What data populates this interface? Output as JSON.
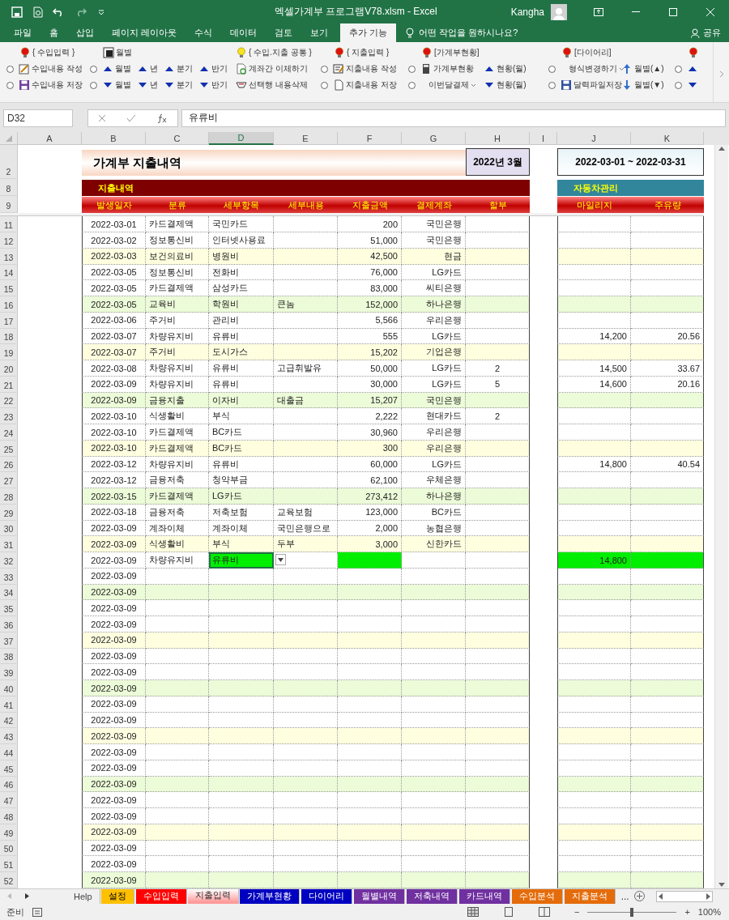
{
  "window": {
    "title": "엑셀가계부 프로그램V78.xlsm  -  Excel",
    "user": "Kangha"
  },
  "menu_tabs": [
    {
      "label": "파일",
      "selected": false
    },
    {
      "label": "홈",
      "selected": false
    },
    {
      "label": "삽입",
      "selected": false
    },
    {
      "label": "페이지 레이아웃",
      "selected": false
    },
    {
      "label": "수식",
      "selected": false
    },
    {
      "label": "데이터",
      "selected": false
    },
    {
      "label": "검토",
      "selected": false
    },
    {
      "label": "보기",
      "selected": false
    },
    {
      "label": "추가 기능",
      "selected": true
    }
  ],
  "tell_me": {
    "placeholder": "어떤 작업을 원하시나요?"
  },
  "share": "공유",
  "ribbon": {
    "columns": [
      {
        "cells": [
          [
            {
              "kind": "item",
              "label": "{ 수입입력 }"
            }
          ],
          [
            {
              "kind": "radio",
              "selected": false
            },
            {
              "kind": "item",
              "label": "수입내용 작성"
            }
          ],
          [
            {
              "kind": "radio",
              "selected": false
            },
            {
              "kind": "item",
              "label": "수입내용 저장"
            }
          ]
        ]
      },
      {
        "cells": [
          [
            {
              "kind": "item",
              "label": "월별"
            }
          ],
          [
            {
              "kind": "radio",
              "selected": false
            },
            {
              "kind": "item",
              "label": "월별"
            },
            {
              "kind": "item",
              "label": "년"
            },
            {
              "kind": "item",
              "label": "분기"
            },
            {
              "kind": "item",
              "label": "반기"
            }
          ],
          [
            {
              "kind": "radio",
              "selected": false
            },
            {
              "kind": "item",
              "label": "월별"
            },
            {
              "kind": "item",
              "label": "년"
            },
            {
              "kind": "item",
              "label": "분기"
            },
            {
              "kind": "item",
              "label": "반기"
            }
          ]
        ]
      },
      {
        "cells": [
          [
            {
              "kind": "item",
              "label": "{ 수입.지출 공통 }"
            }
          ],
          [
            {
              "kind": "item",
              "label": "계좌간 이체하기"
            }
          ],
          [
            {
              "kind": "item",
              "label": "선택행 내용삭제"
            }
          ]
        ]
      },
      {
        "cells": [
          [
            {
              "kind": "item",
              "label": "{ 지출입력 }"
            }
          ],
          [
            {
              "kind": "radio",
              "selected": false
            },
            {
              "kind": "item",
              "label": "지출내용 작성"
            }
          ],
          [
            {
              "kind": "radio",
              "selected": false
            },
            {
              "kind": "item",
              "label": "지출내용 저장"
            }
          ]
        ]
      },
      {
        "cells": [
          [
            {
              "kind": "item",
              "label": "[가계부현황]"
            }
          ],
          [
            {
              "kind": "radio",
              "selected": false
            },
            {
              "kind": "item",
              "label": "가계부현황"
            }
          ],
          [
            {
              "kind": "radio",
              "selected": false
            },
            {
              "kind": "menu",
              "label": "이번달결제"
            }
          ]
        ]
      },
      {
        "cells": [
          [],
          [
            {
              "kind": "item",
              "label": "현황(월)"
            }
          ],
          [
            {
              "kind": "item",
              "label": "현황(월)"
            }
          ]
        ]
      },
      {
        "cells": [
          [
            {
              "kind": "item",
              "label": "[다이어리]"
            }
          ],
          [
            {
              "kind": "radio",
              "selected": false
            },
            {
              "kind": "menu",
              "label": "형식변경하기"
            }
          ],
          [
            {
              "kind": "radio",
              "selected": false
            },
            {
              "kind": "item",
              "label": "달력파일저장"
            }
          ]
        ]
      },
      {
        "cells": [
          [],
          [
            {
              "kind": "item",
              "label": "월별(▲)"
            }
          ],
          [
            {
              "kind": "item",
              "label": "월별(▼)"
            }
          ]
        ]
      },
      {
        "cells": [
          [
            {
              "kind": "item"
            }
          ],
          [
            {
              "kind": "radio",
              "selected": false
            },
            {
              "kind": "item"
            }
          ],
          [
            {
              "kind": "radio",
              "selected": false
            },
            {
              "kind": "item"
            }
          ]
        ]
      }
    ]
  },
  "formula_bar": {
    "name_box": "D32",
    "value": "유류비"
  },
  "columns": [
    {
      "label": "A",
      "selected": false
    },
    {
      "label": "B",
      "selected": false
    },
    {
      "label": "C",
      "selected": false
    },
    {
      "label": "D",
      "selected": true
    },
    {
      "label": "E",
      "selected": false
    },
    {
      "label": "F",
      "selected": false
    },
    {
      "label": "G",
      "selected": false
    },
    {
      "label": "H",
      "selected": false
    },
    {
      "label": "I",
      "selected": false
    },
    {
      "label": "J",
      "selected": false
    },
    {
      "label": "K",
      "selected": false
    }
  ],
  "sheet": {
    "title_row": "2",
    "title": "가계부 지출내역",
    "month": "2022년 3월",
    "period": "2022-03-01 ~ 2022-03-31",
    "section_row": "8",
    "section": "지출내역",
    "car_section": "자동차관리",
    "header_row": "9",
    "headers": [
      "발생일자",
      "분류",
      "세부항목",
      "세부내용",
      "지출금액",
      "결제계좌",
      "할부"
    ],
    "car_headers": [
      "마일리지",
      "주유량"
    ],
    "rows": [
      {
        "n": "11",
        "b": "2022-03-01",
        "c": "카드결제액",
        "d": "국민카드",
        "f": "200",
        "g": "국민은행",
        "highlighted": false,
        "selected": false
      },
      {
        "n": "12",
        "b": "2022-03-02",
        "c": "정보통신비",
        "d": "인터넷사용료",
        "f": "51,000",
        "g": "국민은행",
        "highlighted": false,
        "selected": false
      },
      {
        "n": "13",
        "b": "2022-03-03",
        "c": "보건의료비",
        "d": "병원비",
        "f": "42,500",
        "g": "현금",
        "highlighted": false,
        "selected": false
      },
      {
        "n": "14",
        "b": "2022-03-05",
        "c": "정보통신비",
        "d": "전화비",
        "f": "76,000",
        "g": "LG카드",
        "highlighted": false,
        "selected": false
      },
      {
        "n": "15",
        "b": "2022-03-05",
        "c": "카드결제액",
        "d": "삼성카드",
        "f": "83,000",
        "g": "씨티은행",
        "highlighted": false,
        "selected": false
      },
      {
        "n": "16",
        "b": "2022-03-05",
        "c": "교육비",
        "d": "학원비",
        "e": "큰놈",
        "f": "152,000",
        "g": "하나은행",
        "highlighted": false,
        "selected": false
      },
      {
        "n": "17",
        "b": "2022-03-06",
        "c": "주거비",
        "d": "관리비",
        "f": "5,566",
        "g": "우리은행",
        "highlighted": false,
        "selected": false
      },
      {
        "n": "18",
        "b": "2022-03-07",
        "c": "차량유지비",
        "d": "유류비",
        "f": "555",
        "g": "LG카드",
        "j": "14,200",
        "k": "20.56",
        "highlighted": false,
        "selected": false
      },
      {
        "n": "19",
        "b": "2022-03-07",
        "c": "주거비",
        "d": "도시가스",
        "f": "15,202",
        "g": "기업은행",
        "highlighted": false,
        "selected": false
      },
      {
        "n": "20",
        "b": "2022-03-08",
        "c": "차량유지비",
        "d": "유류비",
        "e": "고급휘발유",
        "f": "50,000",
        "g": "LG카드",
        "h": "2",
        "j": "14,500",
        "k": "33.67",
        "highlighted": false,
        "selected": false
      },
      {
        "n": "21",
        "b": "2022-03-09",
        "c": "차량유지비",
        "d": "유류비",
        "f": "30,000",
        "g": "LG카드",
        "h": "5",
        "j": "14,600",
        "k": "20.16",
        "highlighted": false,
        "selected": false
      },
      {
        "n": "22",
        "b": "2022-03-09",
        "c": "금융지출",
        "d": "이자비",
        "e": "대출금",
        "f": "15,207",
        "g": "국민은행",
        "highlighted": false,
        "selected": false
      },
      {
        "n": "23",
        "b": "2022-03-10",
        "c": "식생활비",
        "d": "부식",
        "f": "2,222",
        "g": "현대카드",
        "h": "2",
        "highlighted": false,
        "selected": false
      },
      {
        "n": "24",
        "b": "2022-03-10",
        "c": "카드결제액",
        "d": "BC카드",
        "f": "30,960",
        "g": "우리은행",
        "highlighted": false,
        "selected": false
      },
      {
        "n": "25",
        "b": "2022-03-10",
        "c": "카드결제액",
        "d": "BC카드",
        "f": "300",
        "g": "우리은행",
        "highlighted": false,
        "selected": false
      },
      {
        "n": "26",
        "b": "2022-03-12",
        "c": "차량유지비",
        "d": "유류비",
        "f": "60,000",
        "g": "LG카드",
        "j": "14,800",
        "k": "40.54",
        "highlighted": false,
        "selected": false
      },
      {
        "n": "27",
        "b": "2022-03-12",
        "c": "금융저축",
        "d": "청약부금",
        "f": "62,100",
        "g": "우체은행",
        "highlighted": false,
        "selected": false
      },
      {
        "n": "28",
        "b": "2022-03-15",
        "c": "카드결제액",
        "d": "LG카드",
        "f": "273,412",
        "g": "하나은행",
        "highlighted": false,
        "selected": false
      },
      {
        "n": "29",
        "b": "2022-03-18",
        "c": "금융저축",
        "d": "저축보험",
        "e": "교육보험",
        "f": "123,000",
        "g": "BC카드",
        "highlighted": false,
        "selected": false
      },
      {
        "n": "30",
        "b": "2022-03-09",
        "c": "계좌이체",
        "d": "계좌이체",
        "e": "국민은행으로",
        "f": "2,000",
        "g": "농협은행",
        "highlighted": false,
        "selected": false
      },
      {
        "n": "31",
        "b": "2022-03-09",
        "c": "식생활비",
        "d": "부식",
        "e": "두부",
        "f": "3,000",
        "g": "신한카드",
        "highlighted": false,
        "selected": false
      },
      {
        "n": "32",
        "b": "2022-03-09",
        "c": "차량유지비",
        "d": "유류비",
        "j": "14,800",
        "highlighted": true,
        "selected": true
      },
      {
        "n": "33",
        "b": "2022-03-09",
        "highlighted": false,
        "selected": false
      },
      {
        "n": "34",
        "b": "2022-03-09",
        "highlighted": false,
        "selected": false
      },
      {
        "n": "35",
        "b": "2022-03-09",
        "highlighted": false,
        "selected": false
      },
      {
        "n": "36",
        "b": "2022-03-09",
        "highlighted": false,
        "selected": false
      },
      {
        "n": "37",
        "b": "2022-03-09",
        "highlighted": false,
        "selected": false
      },
      {
        "n": "38",
        "b": "2022-03-09",
        "highlighted": false,
        "selected": false
      },
      {
        "n": "39",
        "b": "2022-03-09",
        "highlighted": false,
        "selected": false
      },
      {
        "n": "40",
        "b": "2022-03-09",
        "highlighted": false,
        "selected": false
      },
      {
        "n": "41",
        "b": "2022-03-09",
        "highlighted": false,
        "selected": false
      },
      {
        "n": "42",
        "b": "2022-03-09",
        "highlighted": false,
        "selected": false
      },
      {
        "n": "43",
        "b": "2022-03-09",
        "highlighted": false,
        "selected": false
      },
      {
        "n": "44",
        "b": "2022-03-09",
        "highlighted": false,
        "selected": false
      },
      {
        "n": "45",
        "b": "2022-03-09",
        "highlighted": false,
        "selected": false
      },
      {
        "n": "46",
        "b": "2022-03-09",
        "highlighted": false,
        "selected": false
      },
      {
        "n": "47",
        "b": "2022-03-09",
        "highlighted": false,
        "selected": false
      },
      {
        "n": "48",
        "b": "2022-03-09",
        "highlighted": false,
        "selected": false
      },
      {
        "n": "49",
        "b": "2022-03-09",
        "highlighted": false,
        "selected": false
      },
      {
        "n": "50",
        "b": "2022-03-09",
        "highlighted": false,
        "selected": false
      },
      {
        "n": "51",
        "b": "2022-03-09",
        "highlighted": false,
        "selected": false
      },
      {
        "n": "52",
        "b": "2022-03-09",
        "highlighted": false,
        "selected": false
      }
    ]
  },
  "sheet_tabs": [
    {
      "label": "Help",
      "selected": false
    },
    {
      "label": "설정",
      "color": "#ffc000",
      "selected": false
    },
    {
      "label": "수입입력",
      "color": "#ff0000",
      "selected": false
    },
    {
      "label": "지출입력",
      "color": "#ff9999",
      "selected": true
    },
    {
      "label": "가계부현황",
      "color": "#0000c0",
      "selected": false
    },
    {
      "label": "다이어리",
      "color": "#0000c0",
      "selected": false
    },
    {
      "label": "월별내역",
      "color": "#7030a0",
      "selected": false
    },
    {
      "label": "저축내역",
      "color": "#7030a0",
      "selected": false
    },
    {
      "label": "카드내역",
      "color": "#7030a0",
      "selected": false
    },
    {
      "label": "수입분석",
      "color": "#e46c0a",
      "selected": false
    },
    {
      "label": "지출분석",
      "color": "#e46c0a",
      "selected": false
    }
  ],
  "more_tabs": "...",
  "status_bar": {
    "status": "준비",
    "zoom": {
      "level": 0.5,
      "label": "100%",
      "minus": "−",
      "plus": "+"
    }
  }
}
